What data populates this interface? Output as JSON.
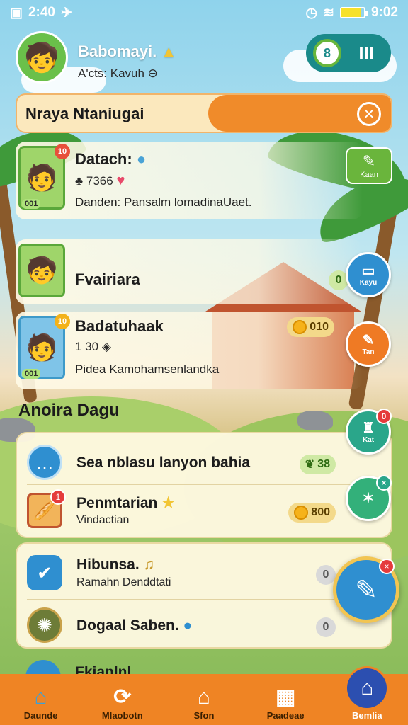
{
  "status_bar": {
    "time": "2:40",
    "right_time": "9:02"
  },
  "header": {
    "username": "Babomayi.",
    "subtitle": "A'cts: Kavuh ⊖"
  },
  "banner": {
    "title": "Nraya Ntaniugai"
  },
  "quests": [
    {
      "title": "Datach:",
      "stat": "7366",
      "description": "Danden: Pansalm lomadinaUaet.",
      "thumb_badge": "10",
      "level": "001"
    },
    {
      "title": "Fvairiara",
      "value": "0",
      "thumb_badge": ""
    },
    {
      "title": "Badatuhaak",
      "stat": "1 30",
      "description": "Pidea Kamohamsenlandka",
      "coins": "010",
      "thumb_badge": "10",
      "level": "001"
    }
  ],
  "side_buttons": {
    "edit_label": "Kaan",
    "b1_label": "Kayu",
    "b2_label": "Tan",
    "b3_label": "Kat",
    "b3_badge": "0",
    "b4_badge": "×"
  },
  "section": {
    "title": "Anoira Dagu"
  },
  "tasks": [
    {
      "title": "Sea nblasu lanyon bahia",
      "value": "38",
      "icon": "chat-icon"
    },
    {
      "title": "Penmtarian",
      "subtitle": "Vindactian",
      "value": "800",
      "icon": "bread-icon",
      "badge": "1"
    },
    {
      "title": "Hibunsa.",
      "subtitle": "Ramahn Denddtati",
      "value": "0",
      "icon": "check-icon"
    },
    {
      "title": "Dogaal Saben.",
      "value": "0",
      "icon": "compass-icon"
    }
  ],
  "peek": {
    "title": "Fkianlnl"
  },
  "fab": {
    "badge": "×"
  },
  "nav": [
    {
      "label": "Daunde",
      "icon": "home-icon"
    },
    {
      "label": "Mlaobotn",
      "icon": "swap-icon"
    },
    {
      "label": "Sfon",
      "icon": "house-icon"
    },
    {
      "label": "Paadeae",
      "icon": "grid-icon"
    },
    {
      "label": "Bemlia",
      "icon": "profile-icon"
    }
  ],
  "colors": {
    "accent": "#ef8424",
    "primary": "#2f8fd0",
    "green": "#6ab53c"
  }
}
